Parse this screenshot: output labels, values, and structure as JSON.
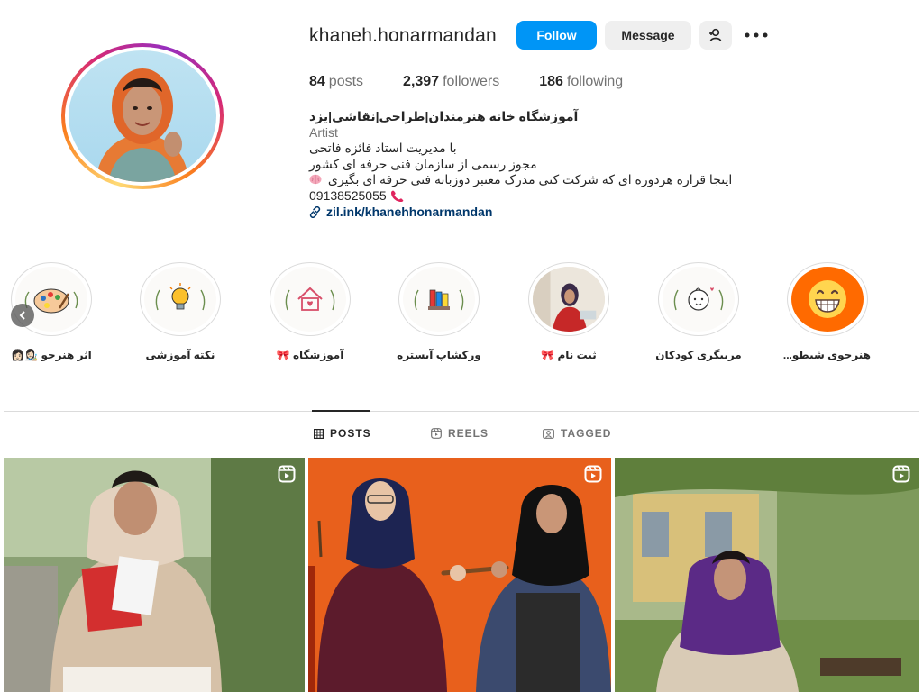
{
  "profile": {
    "username": "khaneh.honarmandan",
    "follow_label": "Follow",
    "message_label": "Message",
    "stats": {
      "posts_count": "84",
      "posts_label": "posts",
      "followers_count": "2,397",
      "followers_label": "followers",
      "following_count": "186",
      "following_label": "following"
    },
    "bio": {
      "full_name": "آموزشگاه خانه هنرمندان|طراحی|نقاشی|یزد",
      "category": "Artist",
      "line1": "با مدیریت استاد فائزه فاتحی",
      "line2": "مجوز رسمی از سازمان فنی حرفه ای کشور",
      "line3": "اینجا قراره هردوره ای که شرکت کنی مدرک معتبر دوزبانه فنی حرفه ای بگیری",
      "phone": "09138525055",
      "link": "zil.ink/khanehhonarmandan"
    }
  },
  "highlights": [
    {
      "label": "اثر هنرجو 👩🏻‍🎨👩🏻",
      "icon": "palette-icon"
    },
    {
      "label": "نکته آموزشی",
      "icon": "lightbulb-icon"
    },
    {
      "label": "آموزشگاه 🎀",
      "icon": "house-icon"
    },
    {
      "label": "ورکشاپ آبستره",
      "icon": "paint-swatches-icon"
    },
    {
      "label": "ثبت نام 🎀",
      "icon": "student-photo"
    },
    {
      "label": "مربیگری کودکان",
      "icon": "baby-face-icon"
    },
    {
      "label": "هنرجوی شیطو...",
      "icon": "grinning-emoji"
    }
  ],
  "tabs": [
    {
      "label": "POSTS",
      "icon": "grid-icon",
      "active": true
    },
    {
      "label": "REELS",
      "icon": "reels-icon",
      "active": false
    },
    {
      "label": "TAGGED",
      "icon": "tagged-icon",
      "active": false
    }
  ],
  "posts": [
    {
      "type": "reel",
      "icon": "reel-badge-icon"
    },
    {
      "type": "reel",
      "icon": "reel-badge-icon"
    },
    {
      "type": "reel",
      "icon": "reel-badge-icon"
    }
  ],
  "colors": {
    "follow_button": "#0095f6",
    "secondary_button": "#efefef",
    "link": "#00376b",
    "muted_text": "#737373",
    "post2_background": "#e8601c",
    "highlight_orange": "#ff6a00"
  }
}
